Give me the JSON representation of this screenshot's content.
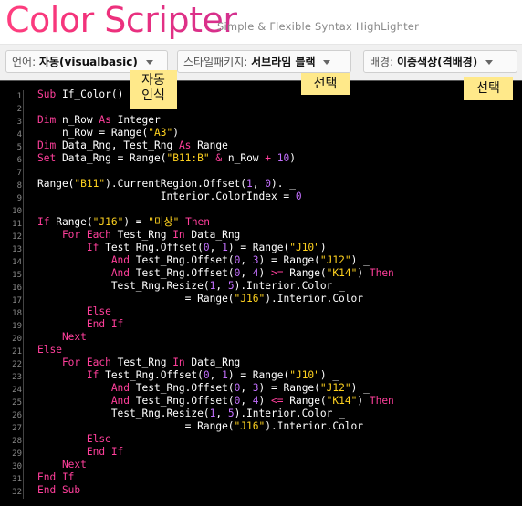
{
  "header": {
    "logo": "Color Scripter",
    "tagline": "Simple & Flexible Syntax HighLighter"
  },
  "toolbar": {
    "language": {
      "label": "언어:",
      "value": "자동(visualbasic)"
    },
    "style": {
      "label": "스타일패키지:",
      "value": "서브라임 블랙"
    },
    "background": {
      "label": "배경:",
      "value": "이중색상(격배경)"
    }
  },
  "annotations": {
    "auto_detect": [
      "자동",
      "인식"
    ],
    "select_style": "선택",
    "select_background": "선택"
  },
  "editor": {
    "line_numbers": [
      "1",
      "2",
      "3",
      "4",
      "5",
      "6",
      "7",
      "8",
      "9",
      "10",
      "11",
      "12",
      "13",
      "14",
      "15",
      "16",
      "17",
      "18",
      "19",
      "20",
      "21",
      "22",
      "23",
      "24",
      "25",
      "26",
      "27",
      "28",
      "29",
      "30",
      "31",
      "32"
    ],
    "lines": [
      [
        [
          "kw",
          "Sub "
        ],
        [
          "fn",
          "If_Color()"
        ]
      ],
      [],
      [
        [
          "kw",
          "Dim "
        ],
        [
          "fn",
          "n_Row "
        ],
        [
          "kw",
          "As "
        ],
        [
          "fn",
          "Integer"
        ]
      ],
      [
        [
          "fn",
          "    n_Row = Range("
        ],
        [
          "str",
          "\"A3\""
        ],
        [
          "fn",
          ")"
        ]
      ],
      [
        [
          "kw",
          "Dim "
        ],
        [
          "fn",
          "Data_Rng, Test_Rng "
        ],
        [
          "kw",
          "As "
        ],
        [
          "fn",
          "Range"
        ]
      ],
      [
        [
          "kw",
          "Set "
        ],
        [
          "fn",
          "Data_Rng = Range("
        ],
        [
          "str",
          "\"B11:B\""
        ],
        [
          "fn",
          " "
        ],
        [
          "op",
          "&"
        ],
        [
          "fn",
          " n_Row "
        ],
        [
          "op",
          "+"
        ],
        [
          "fn",
          " "
        ],
        [
          "num",
          "10"
        ],
        [
          "fn",
          ")"
        ]
      ],
      [],
      [
        [
          "fn",
          "Range("
        ],
        [
          "str",
          "\"B11\""
        ],
        [
          "fn",
          ").CurrentRegion.Offset("
        ],
        [
          "num",
          "1"
        ],
        [
          "fn",
          ", "
        ],
        [
          "num",
          "0"
        ],
        [
          "fn",
          "). _"
        ]
      ],
      [
        [
          "fn",
          "                    Interior.ColorIndex = "
        ],
        [
          "num",
          "0"
        ]
      ],
      [],
      [
        [
          "kw",
          "If "
        ],
        [
          "fn",
          "Range("
        ],
        [
          "str",
          "\"J16\""
        ],
        [
          "fn",
          ") = "
        ],
        [
          "str",
          "\"미상\""
        ],
        [
          "kw",
          " Then"
        ]
      ],
      [
        [
          "kw",
          "    For Each "
        ],
        [
          "fn",
          "Test_Rng "
        ],
        [
          "kw",
          "In "
        ],
        [
          "fn",
          "Data_Rng"
        ]
      ],
      [
        [
          "kw",
          "        If "
        ],
        [
          "fn",
          "Test_Rng.Offset("
        ],
        [
          "num",
          "0"
        ],
        [
          "fn",
          ", "
        ],
        [
          "num",
          "1"
        ],
        [
          "fn",
          ") = Range("
        ],
        [
          "str",
          "\"J10\""
        ],
        [
          "fn",
          ") _"
        ]
      ],
      [
        [
          "kw",
          "            And "
        ],
        [
          "fn",
          "Test_Rng.Offset("
        ],
        [
          "num",
          "0"
        ],
        [
          "fn",
          ", "
        ],
        [
          "num",
          "3"
        ],
        [
          "fn",
          ") = Range("
        ],
        [
          "str",
          "\"J12\""
        ],
        [
          "fn",
          ") _"
        ]
      ],
      [
        [
          "kw",
          "            And "
        ],
        [
          "fn",
          "Test_Rng.Offset("
        ],
        [
          "num",
          "0"
        ],
        [
          "fn",
          ", "
        ],
        [
          "num",
          "4"
        ],
        [
          "fn",
          ") "
        ],
        [
          "op",
          ">="
        ],
        [
          "fn",
          " Range("
        ],
        [
          "str",
          "\"K14\""
        ],
        [
          "fn",
          ") "
        ],
        [
          "kw",
          "Then"
        ]
      ],
      [
        [
          "fn",
          "            Test_Rng.Resize("
        ],
        [
          "num",
          "1"
        ],
        [
          "fn",
          ", "
        ],
        [
          "num",
          "5"
        ],
        [
          "fn",
          ").Interior.Color _"
        ]
      ],
      [
        [
          "fn",
          "                        = Range("
        ],
        [
          "str",
          "\"J16\""
        ],
        [
          "fn",
          ").Interior.Color"
        ]
      ],
      [
        [
          "kw",
          "        Else"
        ]
      ],
      [
        [
          "kw",
          "        End If"
        ]
      ],
      [
        [
          "kw",
          "    Next"
        ]
      ],
      [
        [
          "kw",
          "Else"
        ]
      ],
      [
        [
          "kw",
          "    For Each "
        ],
        [
          "fn",
          "Test_Rng "
        ],
        [
          "kw",
          "In "
        ],
        [
          "fn",
          "Data_Rng"
        ]
      ],
      [
        [
          "kw",
          "        If "
        ],
        [
          "fn",
          "Test_Rng.Offset("
        ],
        [
          "num",
          "0"
        ],
        [
          "fn",
          ", "
        ],
        [
          "num",
          "1"
        ],
        [
          "fn",
          ") = Range("
        ],
        [
          "str",
          "\"J10\""
        ],
        [
          "fn",
          ") _"
        ]
      ],
      [
        [
          "kw",
          "            And "
        ],
        [
          "fn",
          "Test_Rng.Offset("
        ],
        [
          "num",
          "0"
        ],
        [
          "fn",
          ", "
        ],
        [
          "num",
          "3"
        ],
        [
          "fn",
          ") = Range("
        ],
        [
          "str",
          "\"J12\""
        ],
        [
          "fn",
          ") _"
        ]
      ],
      [
        [
          "kw",
          "            And "
        ],
        [
          "fn",
          "Test_Rng.Offset("
        ],
        [
          "num",
          "0"
        ],
        [
          "fn",
          ", "
        ],
        [
          "num",
          "4"
        ],
        [
          "fn",
          ") "
        ],
        [
          "op",
          "<="
        ],
        [
          "fn",
          " Range("
        ],
        [
          "str",
          "\"K14\""
        ],
        [
          "fn",
          ") "
        ],
        [
          "kw",
          "Then"
        ]
      ],
      [
        [
          "fn",
          "            Test_Rng.Resize("
        ],
        [
          "num",
          "1"
        ],
        [
          "fn",
          ", "
        ],
        [
          "num",
          "5"
        ],
        [
          "fn",
          ").Interior.Color _"
        ]
      ],
      [
        [
          "fn",
          "                        = Range("
        ],
        [
          "str",
          "\"J16\""
        ],
        [
          "fn",
          ").Interior.Color"
        ]
      ],
      [
        [
          "kw",
          "        Else"
        ]
      ],
      [
        [
          "kw",
          "        End If"
        ]
      ],
      [
        [
          "kw",
          "    Next"
        ]
      ],
      [
        [
          "kw",
          "End If"
        ]
      ],
      [
        [
          "kw",
          "End Sub"
        ]
      ]
    ]
  },
  "colors": {
    "keyword": "#ff3f9b",
    "string": "#ffd21f",
    "number": "#c470ff",
    "text": "#ffffff",
    "background": "#000000",
    "note": "#ffe98a"
  }
}
